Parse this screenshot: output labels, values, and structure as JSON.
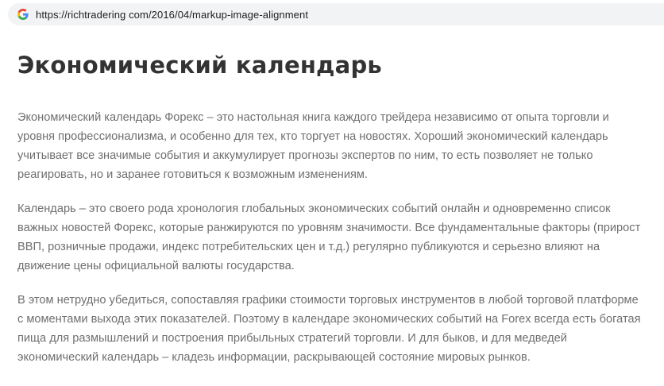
{
  "browser": {
    "url": "https://richtradering com/2016/04/markup-image-alignment",
    "favicon": "google-g-icon"
  },
  "article": {
    "title": "Экономический календарь",
    "paragraphs": [
      "Экономический календарь Форекс – это настольная книга каждого трейдера независимо от опыта торговли и уровня профессионализма, и особенно для тех, кто торгует на новостях. Хороший экономический календарь учитывает все значимые события и аккумулирует прогнозы экспертов по ним, то есть позволяет не только реагировать, но и заранее готовиться к возможным изменениям.",
      "Календарь – это своего рода хронология глобальных экономических событий онлайн и одновременно список важных новостей Форекс, которые ранжируются по уровням значимости. Все фундаментальные факторы (прирост ВВП, розничные продажи, индекс потребительских цен и т.д.) регулярно публикуются и серьезно влияют на движение цены официальной валюты государства.",
      "В этом нетрудно убедиться, сопоставляя графики стоимости торговых инструментов в любой торговой платформе с моментами выхода этих показателей. Поэтому в календаре экономических событий на Forex всегда есть богатая пища для размышлений и построения прибыльных стратегий торговли. И для быков, и для медведей экономический календарь – кладезь информации, раскрывающей состояние мировых рынков."
    ]
  },
  "colors": {
    "title": "#333333",
    "body_text": "#6f6f6f",
    "url_bar_bg": "#f1f3f4"
  }
}
